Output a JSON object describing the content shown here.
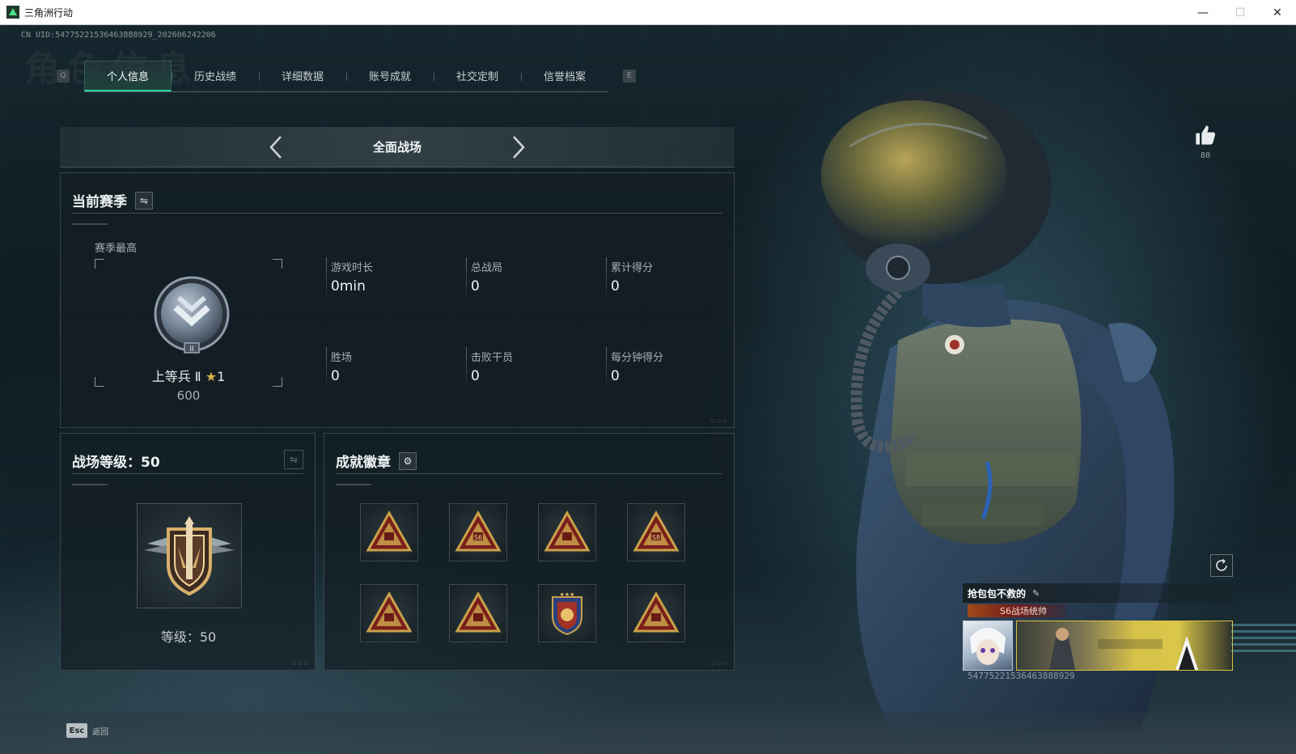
{
  "window": {
    "title": "三角洲行动",
    "controls": {
      "minimize": "—",
      "maximize": "☐",
      "close": "✕"
    }
  },
  "header": {
    "uid_line": "CN UID:547752215364638889​29_202606242206",
    "background_title": "角色信息"
  },
  "tabs": {
    "prev_key": "Q",
    "next_key": "E",
    "items": [
      {
        "label": "个人信息",
        "active": true
      },
      {
        "label": "历史战绩"
      },
      {
        "label": "详细数据"
      },
      {
        "label": "账号成就"
      },
      {
        "label": "社交定制"
      },
      {
        "label": "信誉档案"
      }
    ]
  },
  "mode_selector": {
    "label": "全面战场"
  },
  "season": {
    "title": "当前赛季",
    "swap_icon": "⇋",
    "best_label": "赛季最高",
    "rank_name": "上等兵 Ⅱ",
    "rank_stars": "1",
    "rank_score": "600",
    "stats": [
      {
        "label": "游戏时长",
        "value": "0min"
      },
      {
        "label": "总战局",
        "value": "0"
      },
      {
        "label": "累计得分",
        "value": "0"
      },
      {
        "label": "胜场",
        "value": "0"
      },
      {
        "label": "击败干员",
        "value": "0"
      },
      {
        "label": "每分钟得分",
        "value": "0"
      }
    ]
  },
  "level": {
    "title": "战场等级：50",
    "level_text": "等级：50",
    "swap_icon": "⇋"
  },
  "achievements": {
    "title": "成就徽章",
    "settings_icon": "⚙",
    "badges": [
      "badge-icon",
      "badge-s6-icon",
      "badge-icon",
      "badge-s8-icon",
      "badge-icon",
      "badge-icon",
      "badge-shield-icon",
      "badge-icon"
    ],
    "badge_labels": [
      "",
      "S6",
      "",
      "S8",
      "",
      "",
      "",
      ""
    ]
  },
  "profile": {
    "likes": "80",
    "name": "抢包包不救的",
    "title_badge": "S6战场统帅",
    "id_line": "547752215364638889​29"
  },
  "footer": {
    "esc_key": "Esc",
    "esc_label": "返回"
  },
  "colors": {
    "accent": "#27d39a",
    "badge_gold": "#c9a24a",
    "badge_red": "#7a1f1b",
    "panel_bg": "#141e24"
  }
}
